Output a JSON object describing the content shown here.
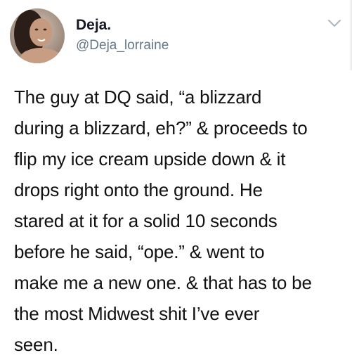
{
  "user": {
    "display_name": "Deja.",
    "handle": "@Deja_lorraine"
  },
  "icons": {
    "avatar": "profile-photo",
    "menu": "chevron-down-icon"
  },
  "colors": {
    "handle": "#657786",
    "caret": "#AAB8C2",
    "text": "#111111"
  },
  "tweet": {
    "lines": [
      "The guy at DQ said, “a blizzard",
      "during a blizzard, eh?” & proceeds to",
      "flip my ice cream upside down & it",
      "drops right onto the ground. He",
      "stared at it for a solid 10 seconds",
      "before he said, “ope.” & went to",
      "make me a new one. & that has to be",
      "the most Midwest shit I’ve ever",
      "seen."
    ]
  }
}
